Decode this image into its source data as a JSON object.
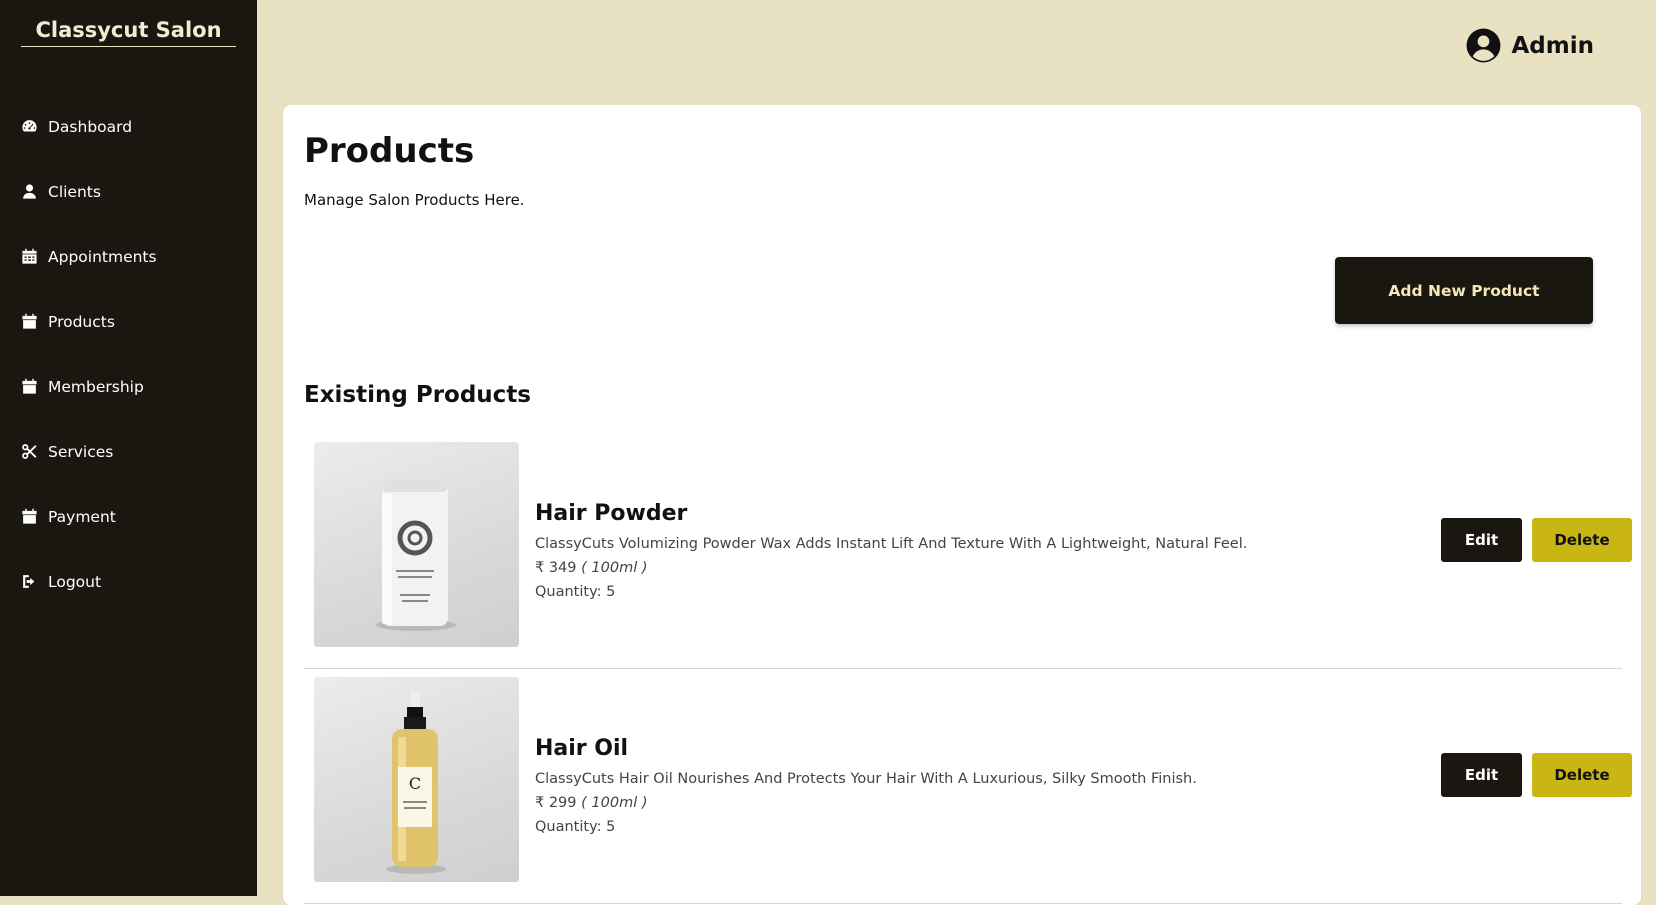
{
  "sidebar": {
    "brand": "Classycut Salon",
    "items": [
      {
        "label": "Dashboard",
        "icon": "gauge-icon"
      },
      {
        "label": "Clients",
        "icon": "user-icon"
      },
      {
        "label": "Appointments",
        "icon": "calendar-icon"
      },
      {
        "label": "Products",
        "icon": "box-icon"
      },
      {
        "label": "Membership",
        "icon": "box-icon"
      },
      {
        "label": "Services",
        "icon": "scissors-icon"
      },
      {
        "label": "Payment",
        "icon": "box-icon"
      },
      {
        "label": "Logout",
        "icon": "logout-icon"
      }
    ]
  },
  "header": {
    "user_label": "Admin",
    "user_icon": "user-circle-icon"
  },
  "main": {
    "title": "Products",
    "subtitle": "Manage Salon Products Here.",
    "add_button": "Add New Product",
    "section_title": "Existing Products",
    "products": [
      {
        "name": "Hair Powder",
        "description": "ClassyCuts Volumizing Powder Wax Adds Instant Lift And Texture With A Lightweight, Natural Feel.",
        "price": "₹ 349",
        "size": "( 100ml )",
        "quantity": "Quantity: 5",
        "edit_label": "Edit",
        "delete_label": "Delete"
      },
      {
        "name": "Hair Oil",
        "description": "ClassyCuts Hair Oil Nourishes And Protects Your Hair With A Luxurious, Silky Smooth Finish.",
        "price": "₹ 299",
        "size": "( 100ml )",
        "quantity": "Quantity: 5",
        "edit_label": "Edit",
        "delete_label": "Delete"
      }
    ]
  },
  "colors": {
    "sidebar_bg": "#1a1711",
    "page_bg": "#e8e2c2",
    "delete_button": "#c9b613",
    "add_button_text": "#f3e9b8"
  }
}
